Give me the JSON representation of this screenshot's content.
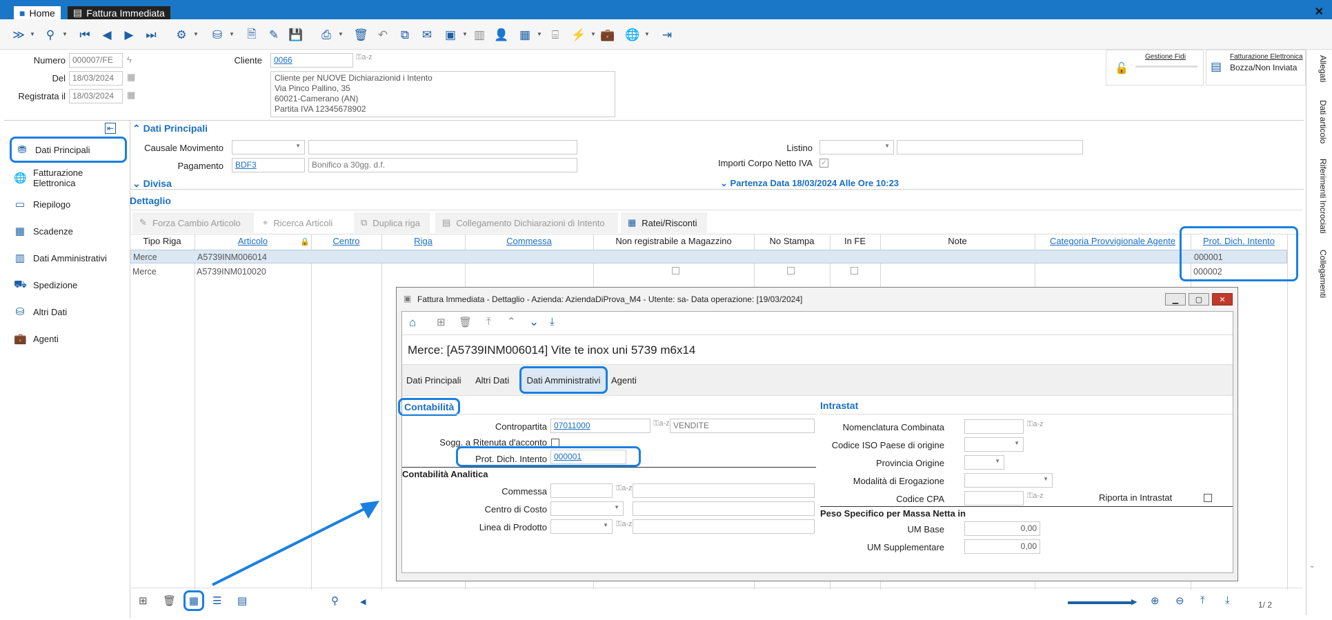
{
  "window": {
    "tabs": [
      {
        "label": "Home"
      },
      {
        "label": "Fattura Immediata"
      }
    ]
  },
  "header": {
    "numero_label": "Numero",
    "numero_value": "000007/FE",
    "del_label": "Del",
    "del_value": "18/03/2024",
    "registrata_label": "Registrata il",
    "registrata_value": "18/03/2024",
    "cliente_label": "Cliente",
    "cliente_value": "0066",
    "cliente_lines": [
      "Cliente per NUOVE Dichiarazionid i Intento",
      "Via Pinco Pallino, 35",
      "60021-Camerano (AN)",
      "Partita IVA 12345678902"
    ],
    "gestione_fidi": "Gestione Fidi",
    "fe_label": "Fatturazione Elettronica",
    "fe_status": "Bozza/Non Inviata"
  },
  "sidebar": {
    "items": [
      {
        "label": "Dati Principali"
      },
      {
        "label": "Fatturazione Elettronica"
      },
      {
        "label": "Riepilogo"
      },
      {
        "label": "Scadenze"
      },
      {
        "label": "Dati Amministrativi"
      },
      {
        "label": "Spedizione"
      },
      {
        "label": "Altri Dati"
      },
      {
        "label": "Agenti"
      }
    ]
  },
  "right_tabs": [
    "Allegati",
    "Dati articolo",
    "Riferimenti Incrociati",
    "Collegamenti"
  ],
  "dati_principali": {
    "title": "Dati Principali",
    "causale_label": "Causale Movimento",
    "pagamento_label": "Pagamento",
    "pagamento_code": "BDF3",
    "pagamento_desc": "Bonifico a 30gg. d.f.",
    "listino_label": "Listino",
    "importi_label": "Importi Corpo Netto IVA",
    "divisa_label": "Divisa",
    "partenza_label": "Partenza Data 18/03/2024 Alle Ore 10:23"
  },
  "dettaglio": {
    "title": "Dettaglio",
    "actions": [
      {
        "label": "Forza Cambio Articolo"
      },
      {
        "label": "Ricerca Articoli"
      },
      {
        "label": "Duplica riga"
      },
      {
        "label": "Collegamento Dichiarazioni di Intento"
      },
      {
        "label": "Ratei/Risconti"
      }
    ],
    "columns": [
      "Tipo Riga",
      "Articolo",
      "Centro",
      "Riga",
      "Commessa",
      "Non registrabile a Magazzino",
      "No Stampa",
      "In FE",
      "Note",
      "Categoria Provvigionale Agente",
      "Prot. Dich. Intento"
    ],
    "rows": [
      {
        "tipo": "Merce",
        "articolo": "A5739INM006014",
        "prot": "000001"
      },
      {
        "tipo": "Merce",
        "articolo": "A5739INM010020",
        "prot": "000002"
      }
    ],
    "pager": "1/  2"
  },
  "dialog": {
    "title": "Fattura Immediata - Dettaglio - Azienda: AziendaDiProva_M4 - Utente: sa- Data operazione: [19/03/2024]",
    "heading": "Merce: [A5739INM006014] Vite te inox uni 5739 m6x14",
    "tabs": [
      {
        "label": "Dati Principali"
      },
      {
        "label": "Altri Dati"
      },
      {
        "label": "Dati Amministrativi"
      },
      {
        "label": "Agenti"
      }
    ],
    "contabilita": {
      "title": "Contabilità",
      "contropartita_label": "Contropartita",
      "contropartita_code": "07011000",
      "contropartita_desc": "VENDITE",
      "ritenuta_label": "Sogg. a Ritenuta d'acconto",
      "prot_label": "Prot. Dich. Intento",
      "prot_value": "000001"
    },
    "analitica": {
      "title": "Contabilità Analitica",
      "commessa_label": "Commessa",
      "centro_label": "Centro di Costo",
      "linea_label": "Linea di Prodotto"
    },
    "intrastat": {
      "title": "Intrastat",
      "nomenclatura_label": "Nomenclatura Combinata",
      "iso_label": "Codice ISO Paese di origine",
      "provincia_label": "Provincia Origine",
      "modalita_label": "Modalità di Erogazione",
      "cpa_label": "Codice CPA",
      "riporta_label": "Riporta in Intrastat"
    },
    "peso": {
      "title": "Peso Specifico per Massa Netta in",
      "um_base_label": "UM Base",
      "um_base_value": "0,00",
      "um_supp_label": "UM Supplementare",
      "um_supp_value": "0,00"
    }
  },
  "colors": {
    "accent": "#1a76c6",
    "highlight": "#1a7fe0",
    "link": "#1a6fc4"
  }
}
